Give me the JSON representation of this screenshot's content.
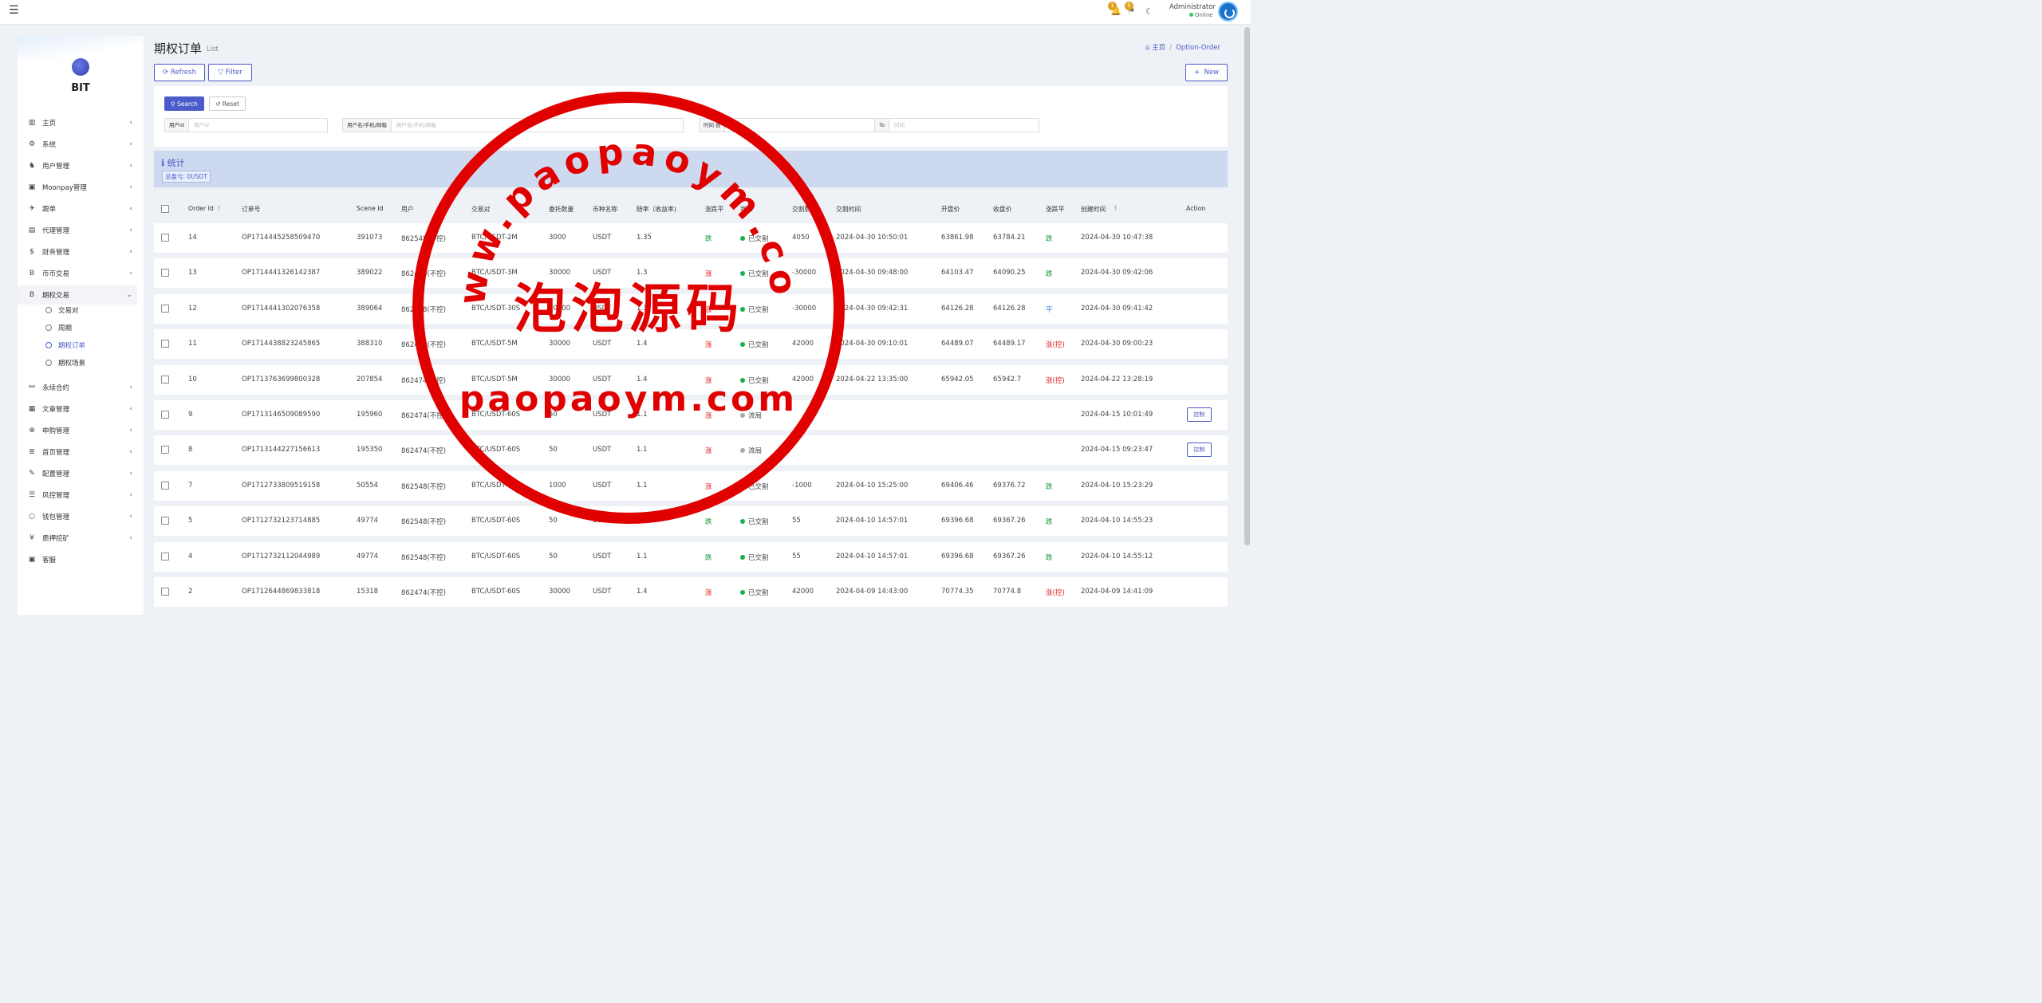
{
  "header": {
    "menu_icon": "☰",
    "notif1": "1",
    "notif2": "0",
    "user": "Administrator",
    "status": "Online"
  },
  "sidebar": {
    "brand": "BIT",
    "items": [
      {
        "label": "主页",
        "icon": "▥"
      },
      {
        "label": "系统",
        "icon": "⚙"
      },
      {
        "label": "用户管理",
        "icon": "♞"
      },
      {
        "label": "Moonpay管理",
        "icon": "▣"
      },
      {
        "label": "跟单",
        "icon": "✈"
      },
      {
        "label": "代理管理",
        "icon": "▤"
      },
      {
        "label": "财务管理",
        "icon": "$"
      },
      {
        "label": "币币交易",
        "icon": "B"
      },
      {
        "label": "期权交易",
        "icon": "B"
      },
      {
        "label": "永续合约",
        "icon": "⚯"
      },
      {
        "label": "文章管理",
        "icon": "▦"
      },
      {
        "label": "申购管理",
        "icon": "⊕"
      },
      {
        "label": "首页管理",
        "icon": "≣"
      },
      {
        "label": "配置管理",
        "icon": "✎"
      },
      {
        "label": "风控管理",
        "icon": "☰"
      },
      {
        "label": "钱包管理",
        "icon": "○"
      },
      {
        "label": "质押挖矿",
        "icon": "¥"
      },
      {
        "label": "客服",
        "icon": "▣"
      }
    ],
    "subitems": [
      {
        "label": "交易对"
      },
      {
        "label": "周期"
      },
      {
        "label": "期权订单"
      },
      {
        "label": "期权场景"
      }
    ]
  },
  "page": {
    "title": "期权订单",
    "subtitle": "List",
    "crumb_home": "主页",
    "crumb_current": "Option-Order"
  },
  "toolbar": {
    "refresh": "Refresh",
    "filter": "Filter",
    "new": "New",
    "search": "Search",
    "reset": "Reset"
  },
  "filters": {
    "userid_label": "用户id",
    "userid_ph": "用户id",
    "user_label": "用户名/手机/邮箱",
    "user_ph": "用户名/手机/邮箱",
    "time_label": "时间",
    "time_ph": "时间",
    "to": "To"
  },
  "stats": {
    "title": "统计",
    "value": "总盈亏: 0USDT"
  },
  "columns": [
    "Order Id",
    "订单号",
    "Scene Id",
    "用户",
    "交易对",
    "委托数量",
    "币种名称",
    "赔率（收益率)",
    "涨跌平",
    "状态",
    "交割数量",
    "交割时间",
    "开盘价",
    "收盘价",
    "涨跌平",
    "创建时间",
    "Action"
  ],
  "rows": [
    {
      "id": "14",
      "no": "OP1714445258509470",
      "scene": "391073",
      "user": "862548(不控)",
      "pair": "BTC/USDT-2M",
      "qty": "3000",
      "coin": "USDT",
      "rate": "1.35",
      "dir": "跌",
      "dc": "dn",
      "status": "已交割",
      "settled": true,
      "sqty": "4050",
      "stime": "2024-04-30 10:50:01",
      "open": "63861.98",
      "close": "63784.21",
      "res": "跌",
      "rc": "dn",
      "created": "2024-04-30 10:47:38",
      "action": ""
    },
    {
      "id": "13",
      "no": "OP1714441326142387",
      "scene": "389022",
      "user": "862468(不控)",
      "pair": "BTC/USDT-3M",
      "qty": "30000",
      "coin": "USDT",
      "rate": "1.3",
      "dir": "涨",
      "dc": "up",
      "status": "已交割",
      "settled": true,
      "sqty": "-30000",
      "stime": "2024-04-30 09:48:00",
      "open": "64103.47",
      "close": "64090.25",
      "res": "跌",
      "rc": "dn",
      "created": "2024-04-30 09:42:06",
      "action": ""
    },
    {
      "id": "12",
      "no": "OP1714441302076358",
      "scene": "389064",
      "user": "862468(不控)",
      "pair": "BTC/USDT-30S",
      "qty": "30000",
      "coin": "USDT",
      "rate": "1.1",
      "dir": "涨",
      "dc": "up",
      "status": "已交割",
      "settled": true,
      "sqty": "-30000",
      "stime": "2024-04-30 09:42:31",
      "open": "64126.28",
      "close": "64126.28",
      "res": "平",
      "rc": "fl",
      "created": "2024-04-30 09:41:42",
      "action": ""
    },
    {
      "id": "11",
      "no": "OP1714438823245865",
      "scene": "388310",
      "user": "862465(不控)",
      "pair": "BTC/USDT-5M",
      "qty": "30000",
      "coin": "USDT",
      "rate": "1.4",
      "dir": "涨",
      "dc": "up",
      "status": "已交割",
      "settled": true,
      "sqty": "42000",
      "stime": "2024-04-30 09:10:01",
      "open": "64489.07",
      "close": "64489.17",
      "res": "涨(控)",
      "rc": "up",
      "created": "2024-04-30 09:00:23",
      "action": ""
    },
    {
      "id": "10",
      "no": "OP1713763699800328",
      "scene": "207854",
      "user": "862474(不控)",
      "pair": "BTC/USDT-5M",
      "qty": "30000",
      "coin": "USDT",
      "rate": "1.4",
      "dir": "涨",
      "dc": "up",
      "status": "已交割",
      "settled": true,
      "sqty": "42000",
      "stime": "2024-04-22 13:35:00",
      "open": "65942.05",
      "close": "65942.7",
      "res": "涨(控)",
      "rc": "up",
      "created": "2024-04-22 13:28:19",
      "action": ""
    },
    {
      "id": "9",
      "no": "OP1713146509089590",
      "scene": "195960",
      "user": "862474(不控)",
      "pair": "BTC/USDT-60S",
      "qty": "50",
      "coin": "USDT",
      "rate": "1.1",
      "dir": "涨",
      "dc": "up",
      "status": "流局",
      "settled": false,
      "sqty": "",
      "stime": "",
      "open": "",
      "close": "",
      "res": "",
      "rc": "",
      "created": "2024-04-15 10:01:49",
      "action": "控制"
    },
    {
      "id": "8",
      "no": "OP1713144227156613",
      "scene": "195350",
      "user": "862474(不控)",
      "pair": "BTC/USDT-60S",
      "qty": "50",
      "coin": "USDT",
      "rate": "1.1",
      "dir": "涨",
      "dc": "up",
      "status": "流局",
      "settled": false,
      "sqty": "",
      "stime": "",
      "open": "",
      "close": "",
      "res": "",
      "rc": "",
      "created": "2024-04-15 09:23:47",
      "action": "控制"
    },
    {
      "id": "7",
      "no": "OP1712733809519158",
      "scene": "50554",
      "user": "862548(不控)",
      "pair": "BTC/USDT-60S",
      "qty": "1000",
      "coin": "USDT",
      "rate": "1.1",
      "dir": "涨",
      "dc": "up",
      "status": "已交割",
      "settled": true,
      "sqty": "-1000",
      "stime": "2024-04-10 15:25:00",
      "open": "69406.46",
      "close": "69376.72",
      "res": "跌",
      "rc": "dn",
      "created": "2024-04-10 15:23:29",
      "action": ""
    },
    {
      "id": "5",
      "no": "OP1712732123714885",
      "scene": "49774",
      "user": "862548(不控)",
      "pair": "BTC/USDT-60S",
      "qty": "50",
      "coin": "USDT",
      "rate": "1.1",
      "dir": "跌",
      "dc": "dn",
      "status": "已交割",
      "settled": true,
      "sqty": "55",
      "stime": "2024-04-10 14:57:01",
      "open": "69396.68",
      "close": "69367.26",
      "res": "跌",
      "rc": "dn",
      "created": "2024-04-10 14:55:23",
      "action": ""
    },
    {
      "id": "4",
      "no": "OP1712732112044989",
      "scene": "49774",
      "user": "862548(不控)",
      "pair": "BTC/USDT-60S",
      "qty": "50",
      "coin": "USDT",
      "rate": "1.1",
      "dir": "跌",
      "dc": "dn",
      "status": "已交割",
      "settled": true,
      "sqty": "55",
      "stime": "2024-04-10 14:57:01",
      "open": "69396.68",
      "close": "69367.26",
      "res": "跌",
      "rc": "dn",
      "created": "2024-04-10 14:55:12",
      "action": ""
    },
    {
      "id": "2",
      "no": "OP1712644869833818",
      "scene": "15318",
      "user": "862474(不控)",
      "pair": "BTC/USDT-60S",
      "qty": "30000",
      "coin": "USDT",
      "rate": "1.4",
      "dir": "涨",
      "dc": "up",
      "status": "已交割",
      "settled": true,
      "sqty": "42000",
      "stime": "2024-04-09 14:43:00",
      "open": "70774.35",
      "close": "70774.8",
      "res": "涨(控)",
      "rc": "up",
      "created": "2024-04-09 14:41:09",
      "action": ""
    }
  ],
  "watermark": {
    "top": "www.paopaoym.com",
    "mid": "泡泡源码",
    "bottom": "paopaoym.com"
  }
}
